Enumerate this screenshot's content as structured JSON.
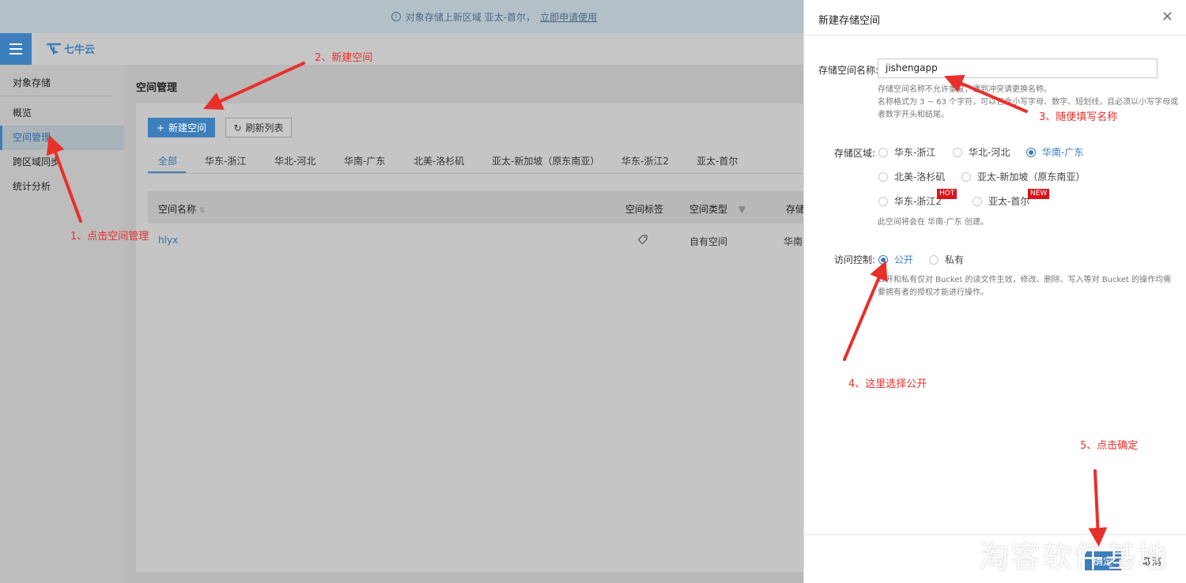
{
  "notice": {
    "text": "对象存储上新区域 亚太-首尔，",
    "link": "立即申请使用"
  },
  "app": {
    "logo_text": "七牛云"
  },
  "sidebar": {
    "section": "对象存储",
    "items": [
      {
        "label": "概览"
      },
      {
        "label": "空间管理"
      },
      {
        "label": "跨区域同步"
      },
      {
        "label": "统计分析"
      }
    ]
  },
  "main": {
    "title": "空间管理",
    "new_button": "新建空间",
    "refresh_button": "刷新列表",
    "tabs": [
      "全部",
      "华东-浙江",
      "华北-河北",
      "华南-广东",
      "北美-洛杉矶",
      "亚太-新加坡（原东南亚）",
      "华东-浙江2",
      "亚太-首尔"
    ],
    "table": {
      "columns": [
        "空间名称",
        "空间标签",
        "空间类型",
        "存储"
      ],
      "rows": [
        {
          "name": "hlyx",
          "type": "自有空间",
          "region": "华南-"
        }
      ]
    }
  },
  "drawer": {
    "title": "新建存储空间",
    "name_label": "存储空间名称:",
    "name_value": "jishengapp",
    "name_hint": [
      "存储空间名称不允许重复，遇到冲突请更换名称。",
      "名称格式为 3 ~ 63 个字符，可以包含小写字母、数字、短划线，且必须以小写字母或",
      "者数字开头和结尾。"
    ],
    "region_label": "存储区域:",
    "regions": [
      "华东-浙江",
      "华北-河北",
      "华南-广东",
      "北美-洛杉矶",
      "亚太-新加坡（原东南亚）",
      "华东-浙江2",
      "亚太-首尔"
    ],
    "selected_region": "华南-广东",
    "badges": {
      "hot": "HOT",
      "new": "NEW"
    },
    "region_hint": "此空间将会在 华南-广东 创建。",
    "access_label": "访问控制:",
    "access_options": [
      "公开",
      "私有"
    ],
    "access_hint": [
      "公开和私有仅对 Bucket 的读文件生效，修改、删除、写入等对 Bucket 的操作均需",
      "要拥有者的授权才能进行操作。"
    ],
    "ok_button": "确定",
    "cancel_button": "取消"
  },
  "annotations": {
    "step1": "1、点击空间管理",
    "step2": "2、新建空间",
    "step3": "3、随便填写名称",
    "step4": "4、这里选择公开",
    "step5": "5、点击确定"
  },
  "watermark": "淘客软件基地",
  "colors": {
    "accent": "#3d7fbd",
    "annotation": "#e8302a",
    "badge": "#d9151b"
  }
}
